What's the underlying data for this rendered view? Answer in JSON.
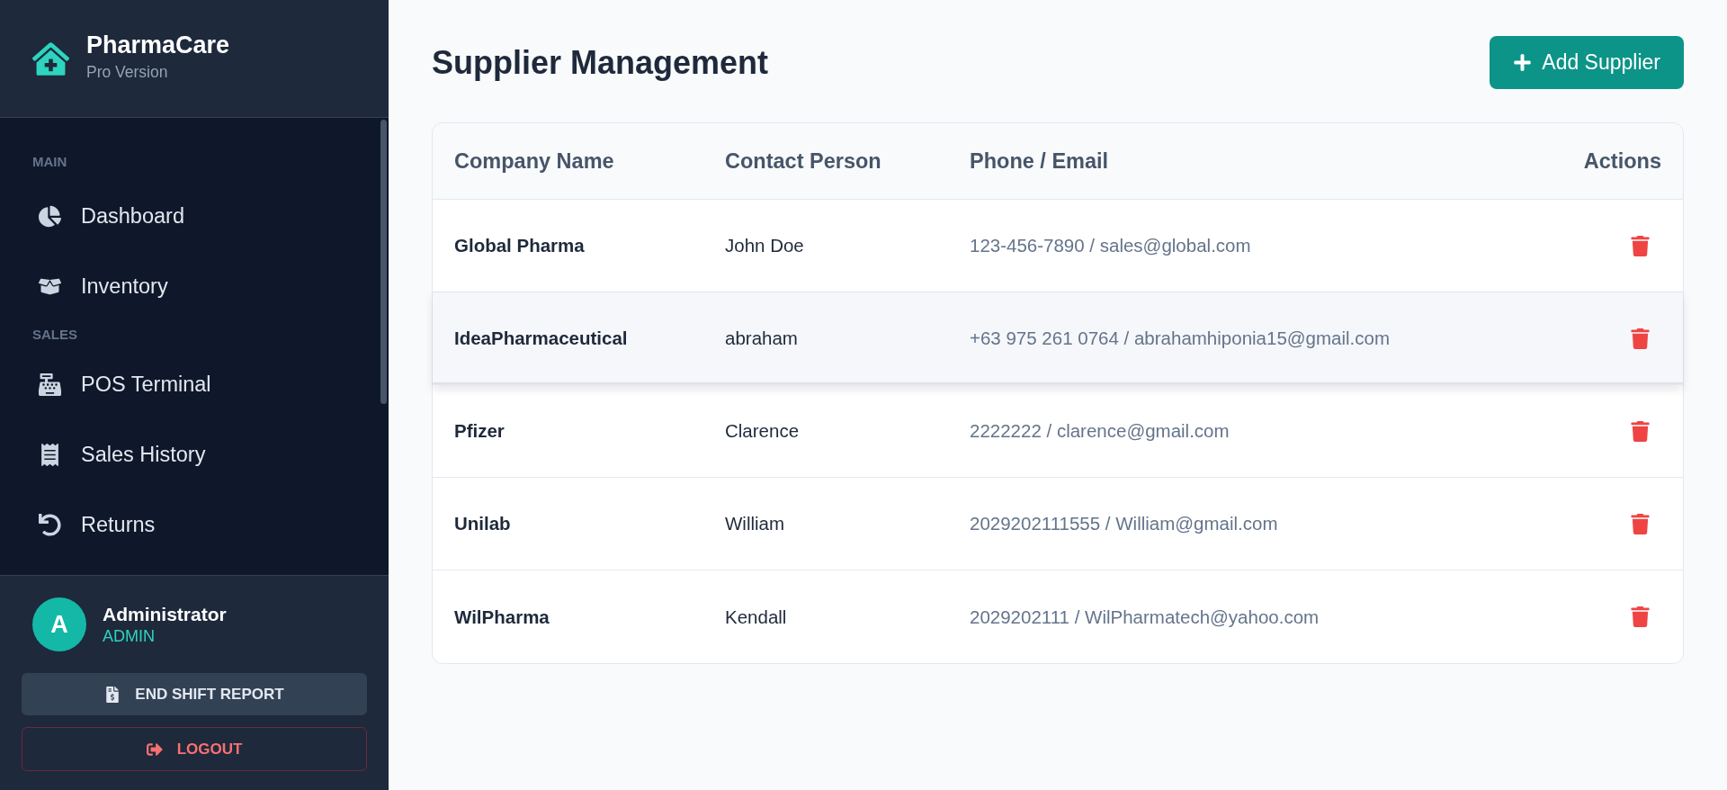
{
  "sidebar": {
    "brand": {
      "name": "PharmaCare",
      "subtitle": "Pro Version"
    },
    "sections": [
      {
        "label": "MAIN",
        "items": [
          {
            "label": "Dashboard",
            "selected": false
          },
          {
            "label": "Inventory",
            "selected": false
          }
        ]
      },
      {
        "label": "SALES",
        "items": [
          {
            "label": "POS Terminal",
            "selected": false
          },
          {
            "label": "Sales History",
            "selected": false
          },
          {
            "label": "Returns",
            "selected": false
          }
        ]
      }
    ],
    "user": {
      "initial": "A",
      "name": "Administrator",
      "role": "ADMIN"
    },
    "buttons": [
      {
        "kind": "report",
        "label": "END SHIFT REPORT"
      },
      {
        "kind": "logout",
        "label": "LOGOUT"
      }
    ]
  },
  "page": {
    "title": "Supplier Management",
    "add_button": "Add Supplier"
  },
  "table": {
    "columns": [
      "Company Name",
      "Contact Person",
      "Phone / Email",
      "Actions"
    ],
    "rows": [
      {
        "company": "Global Pharma",
        "contact": "John Doe",
        "phone_email": "123-456-7890 / sales@global.com",
        "hovered": false
      },
      {
        "company": "IdeaPharmaceutical",
        "contact": "abraham",
        "phone_email": "+63 975 261 0764 / abrahamhiponia15@gmail.com",
        "hovered": true
      },
      {
        "company": "Pfizer",
        "contact": "Clarence",
        "phone_email": "2222222 / clarence@gmail.com",
        "hovered": false
      },
      {
        "company": "Unilab",
        "contact": "William",
        "phone_email": "2029202111555 / William@gmail.com",
        "hovered": false
      },
      {
        "company": "WilPharma",
        "contact": "Kendall",
        "phone_email": "2029202111 / WilPharmatech@yahoo.com",
        "hovered": false
      }
    ]
  }
}
